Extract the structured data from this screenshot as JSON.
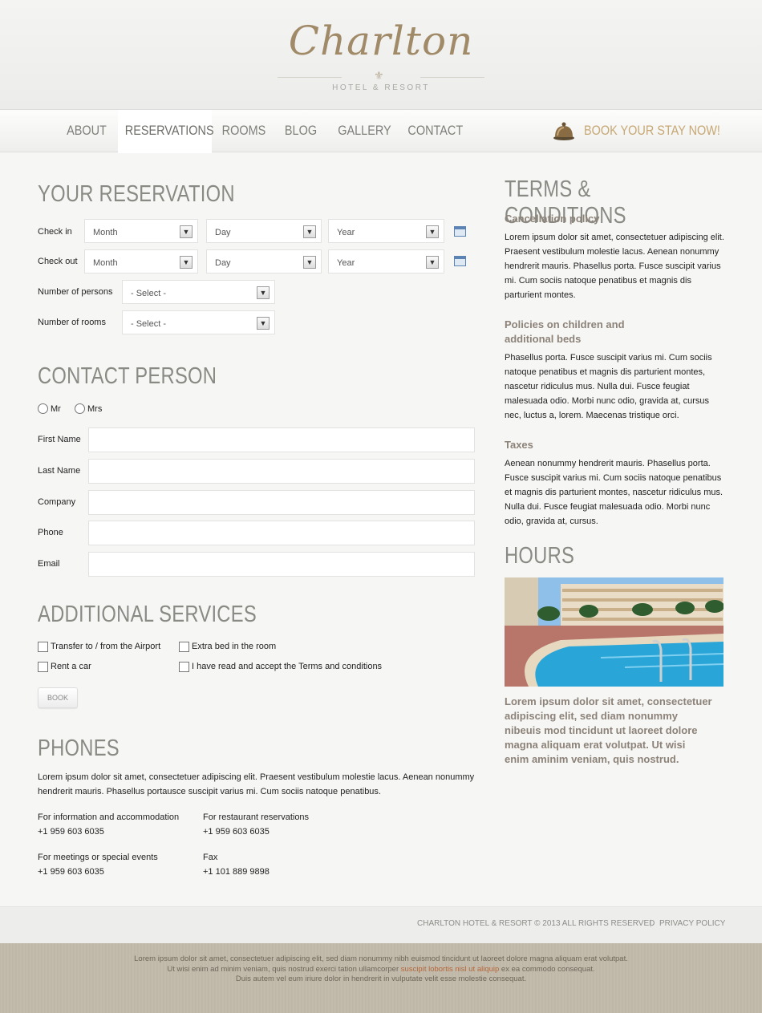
{
  "brand": {
    "name": "Charlton",
    "subtitle": "HOTEL & RESORT"
  },
  "nav": {
    "items": [
      "ABOUT",
      "RESERVATIONS",
      "ROOMS",
      "BLOG",
      "GALLERY",
      "CONTACT"
    ],
    "active": "RESERVATIONS",
    "cta": "BOOK YOUR STAY NOW!"
  },
  "reservation": {
    "title": "YOUR RESERVATION",
    "checkin_label": "Check in",
    "checkout_label": "Check out",
    "month": "Month",
    "day": "Day",
    "year": "Year",
    "persons_label": "Number of persons",
    "rooms_label": "Number of rooms",
    "select_placeholder": "- Select -"
  },
  "contact": {
    "title": "CONTACT PERSON",
    "mr": "Mr",
    "mrs": "Mrs",
    "first_name": "First Name",
    "last_name": "Last Name",
    "company": "Company",
    "phone": "Phone",
    "email": "Email"
  },
  "services": {
    "title": "ADDITIONAL SERVICES",
    "transfer": "Transfer to / from the Airport",
    "extra_bed": "Extra bed in the room",
    "rent_car": "Rent a car",
    "terms": "I have read and accept the Terms and conditions",
    "book_button": "BOOK"
  },
  "phones": {
    "title": "PHONES",
    "intro_line1": "Lorem ipsum dolor sit amet, consectetuer adipiscing elit. Praesent vestibulum molestie lacus. Aenean nonummy",
    "intro_line2": "hendrerit mauris. Phasellus portausce suscipit varius mi. Cum sociis natoque penatibus.",
    "info_label": "For information and accommodation",
    "info_number": "+1 959 603 6035",
    "restaurant_label": "For restaurant reservations",
    "restaurant_number": "+1 959 603 6035",
    "meetings_label": "For meetings or special events",
    "meetings_number": "+1 959 603 6035",
    "fax_label": "Fax",
    "fax_number": "+1 101 889 9898"
  },
  "terms": {
    "title": "TERMS & CONDITIONS",
    "cancellation_title": "Cancellation policy",
    "cancellation_lines": [
      "Lorem ipsum dolor sit amet, consectetuer adipiscing elit.",
      "Praesent vestibulum molestie lacus. Aenean nonummy",
      "hendrerit mauris. Phasellus porta. Fusce suscipit varius",
      "mi. Cum sociis natoque penatibus et magnis dis",
      "parturient montes."
    ],
    "children_title_1": "Policies on children and",
    "children_title_2": "additional beds",
    "children_lines": [
      "Phasellus porta. Fusce suscipit varius mi. Cum sociis",
      "natoque penatibus et magnis dis parturient montes,",
      "nascetur ridiculus mus. Nulla dui. Fusce feugiat",
      "malesuada odio. Morbi nunc odio, gravida at, cursus",
      "nec, luctus a, lorem. Maecenas tristique orci."
    ],
    "taxes_title": "Taxes",
    "taxes_lines": [
      "Aenean nonummy hendrerit mauris. Phasellus porta.",
      "Fusce suscipit varius mi. Cum sociis natoque penatibus",
      "et magnis dis parturient montes, nascetur ridiculus mus.",
      "Nulla dui. Fusce feugiat malesuada odio. Morbi nunc",
      "odio, gravida at, cursus."
    ]
  },
  "hours": {
    "title": "HOURS",
    "caption_lines": [
      "Lorem ipsum dolor sit amet, consectetuer",
      "adipiscing elit, sed diam nonummy",
      "nibeuis mod tincidunt ut laoreet dolore",
      "magna aliquam erat volutpat. Ut wisi",
      "enim aminim veniam, quis nostrud."
    ]
  },
  "footer": {
    "copyright": "CHARLTON HOTEL & RESORT © 2013 ALL RIGHTS RESERVED",
    "separator": "|",
    "privacy": "PRIVACY POLICY",
    "bottom_line1": "Lorem ipsum dolor sit amet, consectetuer adipiscing elit, sed diam nonummy nibh euismod tincidunt ut laoreet dolore magna aliquam erat volutpat.",
    "bottom_line2_a": "Ut wisi enim ad minim veniam, quis nostrud exerci tation ullamcorper ",
    "bottom_line2_link": "suscipit lobortis nisl ut aliquip",
    "bottom_line2_b": " ex ea commodo consequat.",
    "bottom_line3": "Duis autem vel eum iriure dolor in hendrerit in vulputate velit esse molestie consequat."
  },
  "colors": {
    "accent_gold": "#c7a874",
    "heading_gray": "#8a8a85",
    "subhead_brown": "#8c8278",
    "link_orange": "#b5663a"
  }
}
